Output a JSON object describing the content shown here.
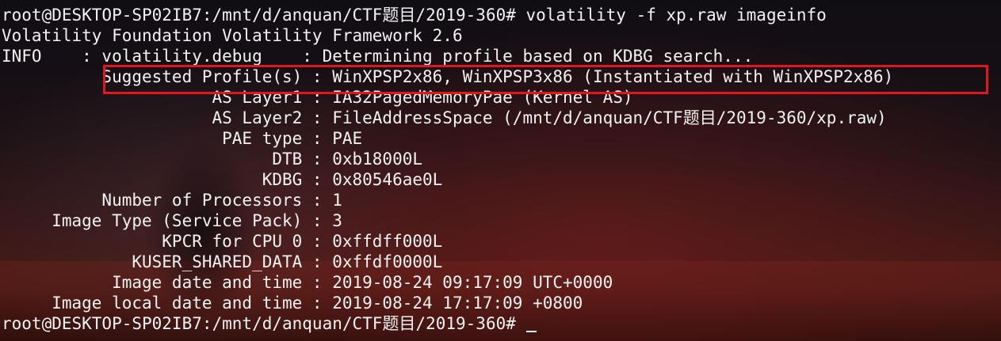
{
  "terminal": {
    "lines": [
      "root@DESKTOP-SP02IB7:/mnt/d/anquan/CTF题目/2019-360# volatility -f xp.raw imageinfo",
      "Volatility Foundation Volatility Framework 2.6",
      "INFO    : volatility.debug    : Determining profile based on KDBG search...",
      "          Suggested Profile(s) : WinXPSP2x86, WinXPSP3x86 (Instantiated with WinXPSP2x86)",
      "                     AS Layer1 : IA32PagedMemoryPae (Kernel AS)",
      "                     AS Layer2 : FileAddressSpace (/mnt/d/anquan/CTF题目/2019-360/xp.raw)",
      "                      PAE type : PAE",
      "                           DTB : 0xb18000L",
      "                          KDBG : 0x80546ae0L",
      "          Number of Processors : 1",
      "     Image Type (Service Pack) : 3",
      "                KPCR for CPU 0 : 0xffdff000L",
      "             KUSER_SHARED_DATA : 0xffdf0000L",
      "           Image date and time : 2019-08-24 09:17:09 UTC+0000",
      "     Image local date and time : 2019-08-24 17:17:09 +0800"
    ],
    "prompt": "root@DESKTOP-SP02IB7:/mnt/d/anquan/CTF题目/2019-360# "
  },
  "colors": {
    "text": "#f2f2f2",
    "highlight_border": "#e3151d"
  }
}
